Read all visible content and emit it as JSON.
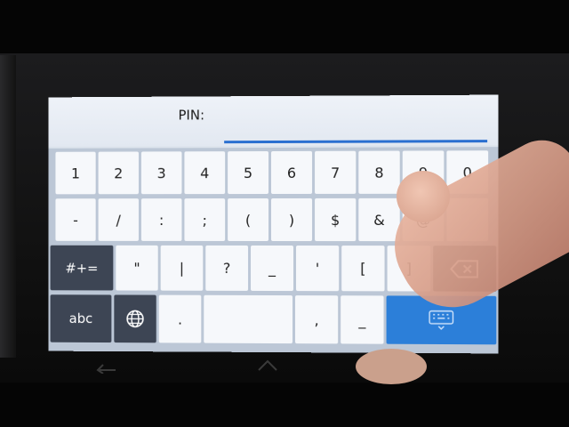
{
  "screen": {
    "pin_label": "PIN:"
  },
  "keyboard": {
    "row1": [
      "1",
      "2",
      "3",
      "4",
      "5",
      "6",
      "7",
      "8",
      "9",
      "0"
    ],
    "row2": [
      "-",
      "/",
      ":",
      ";",
      "(",
      ")",
      "$",
      "&",
      "@"
    ],
    "row3": [
      "\"",
      "|",
      "?",
      "_",
      "'",
      "[",
      "]"
    ],
    "mode_symbols_label": "#+=",
    "mode_abc_label": "abc",
    "period_label": ".",
    "comma_label": ",",
    "dash_label": "_"
  },
  "icons": {
    "backspace": "backspace-icon",
    "globe": "globe-icon",
    "hide_keyboard": "keyboard-hide-icon",
    "nav_back": "back-arrow-icon",
    "nav_home": "home-icon"
  },
  "colors": {
    "key_bg": "#f6f8fb",
    "key_dark": "#3d4554",
    "accent_blue": "#2c7fd9",
    "pin_underline": "#2a6fd0"
  }
}
